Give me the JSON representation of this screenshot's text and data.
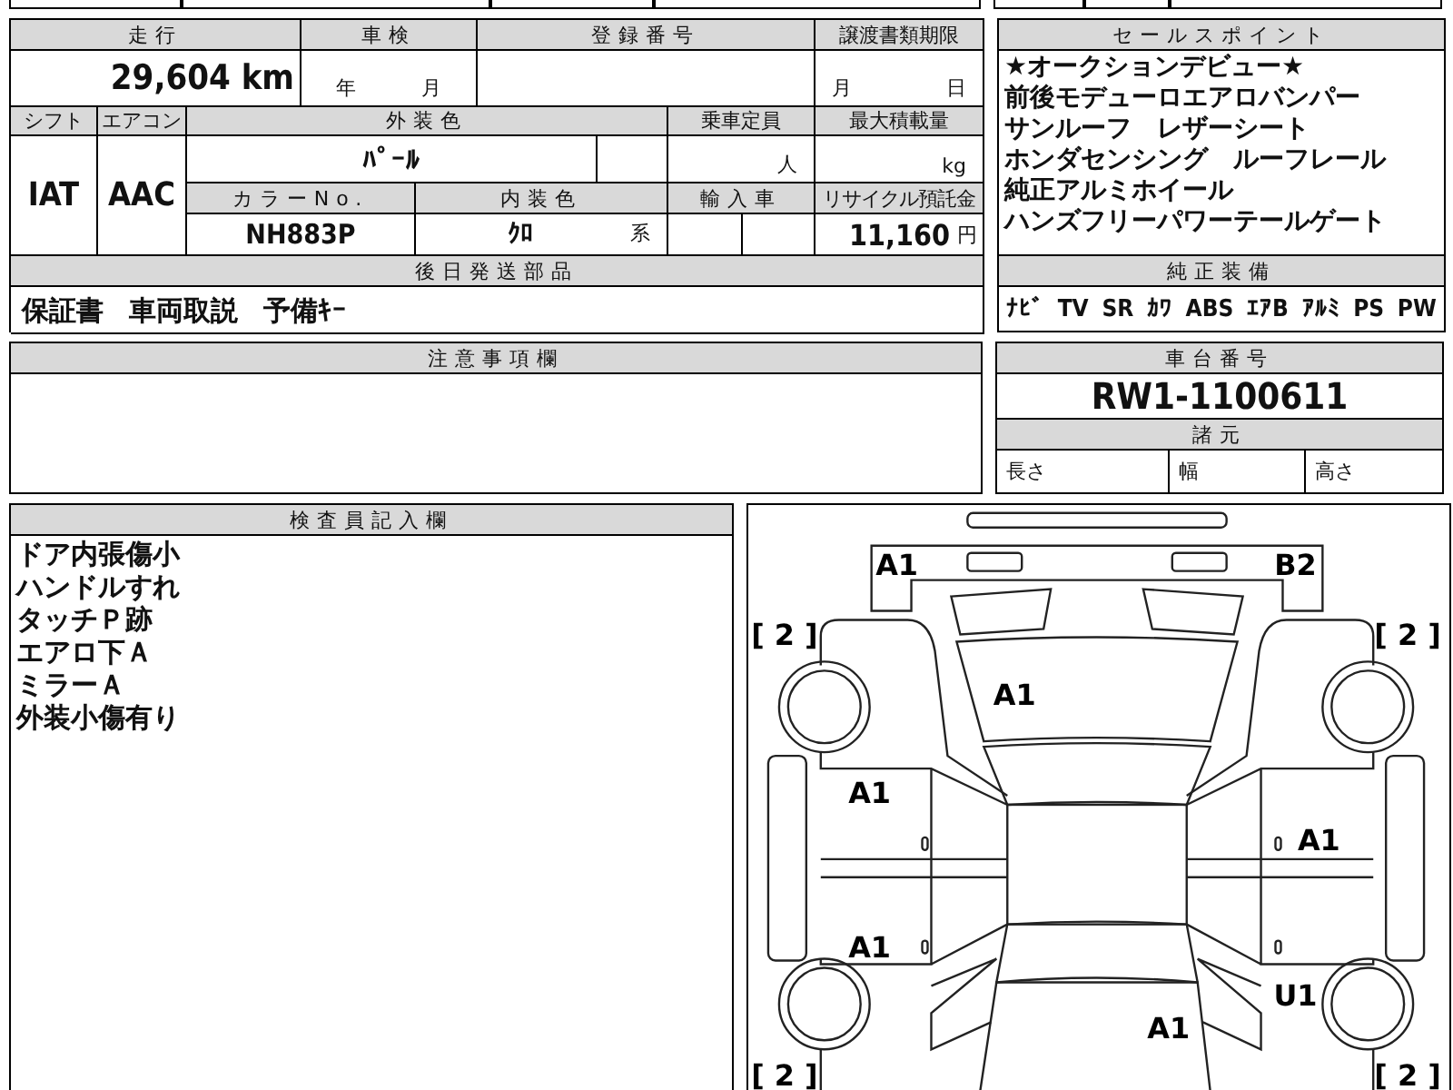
{
  "form": {
    "mileage_label": "走行",
    "mileage": "29,604 km",
    "inspection_label": "車検",
    "inspection_year_unit": "年",
    "inspection_month_unit": "月",
    "registration_label": "登録番号",
    "transfer_deadline_label": "譲渡書類期限",
    "transfer_month_unit": "月",
    "transfer_day_unit": "日",
    "shift_label": "シフト",
    "shift": "IAT",
    "ac_label": "エアコン",
    "ac": "AAC",
    "exterior_color_label": "外装色",
    "exterior_color": "ﾊﾟｰﾙ",
    "capacity_label": "乗車定員",
    "capacity_unit": "人",
    "max_load_label": "最大積載量",
    "max_load_unit": "kg",
    "color_no_label": "カラーNo.",
    "color_no": "NH883P",
    "interior_color_label": "内装色",
    "interior_color": "ｸﾛ",
    "interior_color_suffix": "系",
    "import_label": "輸入車",
    "recycle_label": "リサイクル預託金",
    "recycle_fee": "11,160",
    "recycle_unit": "円",
    "later_parts_label": "後日発送部品",
    "later_parts": [
      "保証書",
      "車両取説",
      "予備ｷｰ"
    ]
  },
  "notes": {
    "label": "注意事項欄"
  },
  "sales_points": {
    "label": "セールスポイント",
    "lines": [
      "★オークションデビュー★",
      "前後モデューロエアロバンパー",
      "サンルーフ　レザーシート",
      "ホンダセンシング　ルーフレール",
      "純正アルミホイール",
      "ハンズフリーパワーテールゲート"
    ]
  },
  "standard_equipment": {
    "label": "純正装備",
    "items": [
      "ﾅﾋﾞ",
      "TV",
      "SR",
      "ｶﾜ",
      "ABS",
      "ｴｱB",
      "ｱﾙﾐ",
      "PS",
      "PW"
    ]
  },
  "chassis": {
    "label": "車台番号",
    "number": "RW1-1100611",
    "specs_label": "諸元",
    "specs": [
      {
        "label": "長さ"
      },
      {
        "label": "幅"
      },
      {
        "label": "高さ"
      }
    ]
  },
  "inspector": {
    "label": "検査員記入欄",
    "lines": [
      "ドア内張傷小",
      "ハンドルすれ",
      "タッチＰ跡",
      "エアロ下Ａ",
      "ミラーＡ",
      "外装小傷有り"
    ]
  },
  "diagram": {
    "damage_marks": {
      "front_bumper_left": "A1",
      "front_bumper_right": "B2",
      "hood": "A1",
      "left_front_door": "A1",
      "left_rear_door": "A1",
      "right_front_door": "A1",
      "right_rear_fender": "U1",
      "trunk": "A1"
    },
    "tire_marks": {
      "front_left": "[ 2 ]",
      "front_right": "[ 2 ]",
      "rear_left": "[ 2 ]",
      "rear_right": "[ 2 ]"
    }
  }
}
